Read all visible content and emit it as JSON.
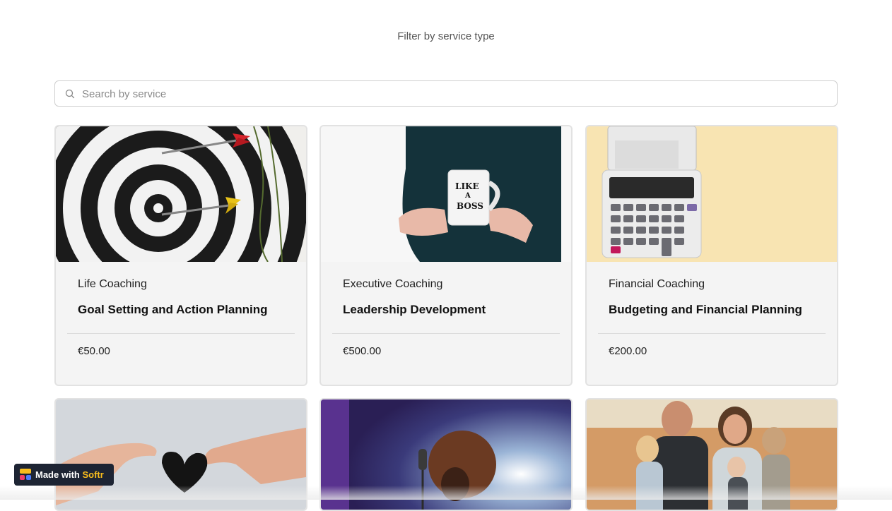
{
  "filter": {
    "label": "Filter by service type"
  },
  "search": {
    "placeholder": "Search by service",
    "value": ""
  },
  "cards": [
    {
      "category": "Life Coaching",
      "title": "Goal Setting and Action Planning",
      "price": "€50.00",
      "image": "dartboard-image"
    },
    {
      "category": "Executive Coaching",
      "title": "Leadership Development",
      "price": "€500.00",
      "image": "like-a-boss-mug-image"
    },
    {
      "category": "Financial Coaching",
      "title": "Budgeting and Financial Planning",
      "price": "€200.00",
      "image": "calculator-image"
    },
    {
      "image": "hands-heart-image"
    },
    {
      "image": "singer-stage-image"
    },
    {
      "image": "family-field-image"
    }
  ],
  "mug_text": {
    "line1": "LIKE",
    "line2": "A",
    "line3": "BOSS"
  },
  "badge": {
    "made_with": "Made with ",
    "brand": "Softr"
  },
  "colors": {
    "card_bg": "#f4f4f4",
    "brand_yellow": "#f9bd1d",
    "badge_bg": "#1d2433"
  }
}
